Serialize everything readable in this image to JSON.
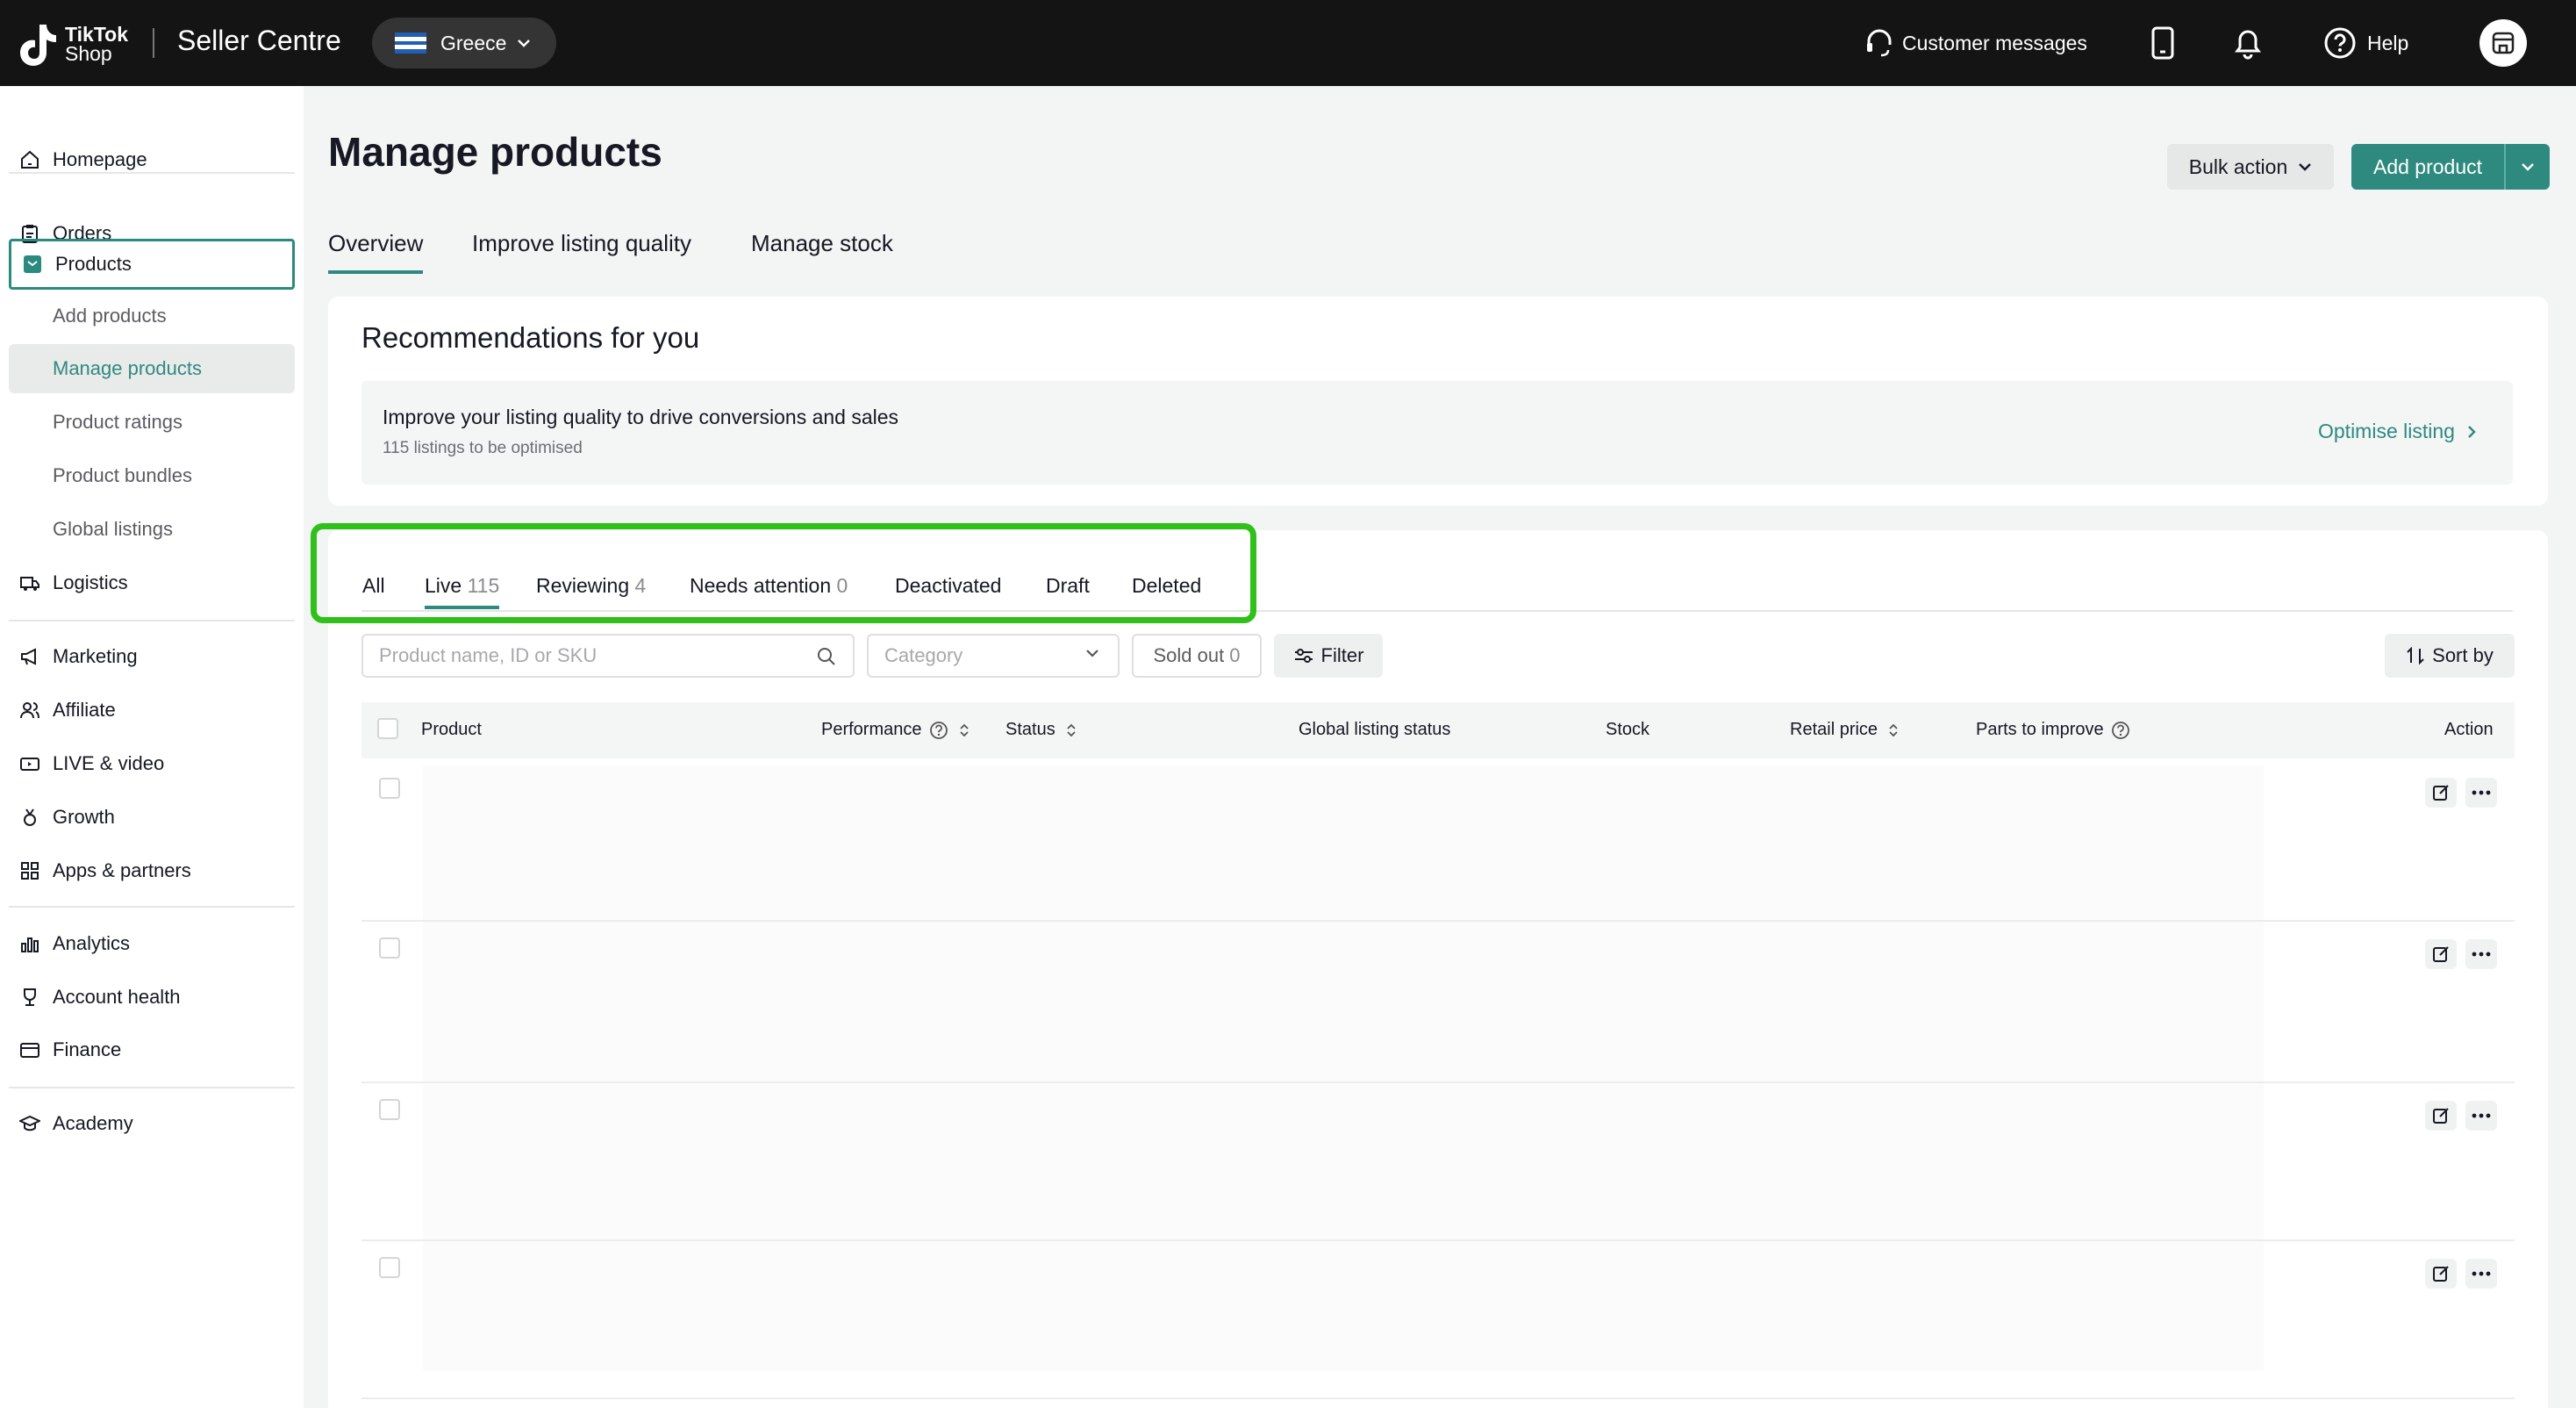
{
  "header": {
    "logo_line1": "TikTok",
    "logo_line2": "Shop",
    "app_title": "Seller Centre",
    "region": "Greece",
    "customer_messages": "Customer messages",
    "help": "Help"
  },
  "sidebar": {
    "items": [
      {
        "label": "Homepage",
        "icon": "home-icon"
      },
      {
        "label": "Orders",
        "icon": "clipboard-icon"
      },
      {
        "label": "Products",
        "icon": "product-box-icon"
      },
      {
        "label": "Add products"
      },
      {
        "label": "Manage products"
      },
      {
        "label": "Product ratings"
      },
      {
        "label": "Product bundles"
      },
      {
        "label": "Global listings"
      },
      {
        "label": "Logistics",
        "icon": "truck-icon"
      },
      {
        "label": "Marketing",
        "icon": "megaphone-icon"
      },
      {
        "label": "Affiliate",
        "icon": "people-icon"
      },
      {
        "label": "LIVE & video",
        "icon": "live-video-icon"
      },
      {
        "label": "Growth",
        "icon": "medal-icon"
      },
      {
        "label": "Apps & partners",
        "icon": "apps-grid-icon"
      },
      {
        "label": "Analytics",
        "icon": "bar-chart-icon"
      },
      {
        "label": "Account health",
        "icon": "trophy-icon"
      },
      {
        "label": "Finance",
        "icon": "wallet-icon"
      },
      {
        "label": "Academy",
        "icon": "graduation-cap-icon"
      }
    ]
  },
  "main": {
    "title": "Manage products",
    "bulk_action": "Bulk action",
    "add_product": "Add product",
    "tabs": [
      {
        "label": "Overview"
      },
      {
        "label": "Improve listing quality"
      },
      {
        "label": "Manage stock"
      }
    ],
    "recommendations": {
      "title": "Recommendations for you",
      "headline": "Improve your listing quality to drive conversions and sales",
      "subtext": "115 listings to be optimised",
      "link": "Optimise listing"
    },
    "status_tabs": [
      {
        "label": "All",
        "count": ""
      },
      {
        "label": "Live",
        "count": "115"
      },
      {
        "label": "Reviewing",
        "count": "4"
      },
      {
        "label": "Needs attention",
        "count": "0"
      },
      {
        "label": "Deactivated",
        "count": ""
      },
      {
        "label": "Draft",
        "count": ""
      },
      {
        "label": "Deleted",
        "count": ""
      }
    ],
    "search_placeholder": "Product name, ID or SKU",
    "category_placeholder": "Category",
    "sold_out_label": "Sold out",
    "sold_out_count": "0",
    "filter_label": "Filter",
    "sort_label": "Sort by",
    "columns": [
      {
        "label": "Product"
      },
      {
        "label": "Performance"
      },
      {
        "label": "Status"
      },
      {
        "label": "Global listing status"
      },
      {
        "label": "Stock"
      },
      {
        "label": "Retail price"
      },
      {
        "label": "Parts to improve"
      },
      {
        "label": "Action"
      }
    ]
  },
  "colors": {
    "accent": "#2e8a7f",
    "highlight": "#2fc01a",
    "topbar": "#141414"
  }
}
